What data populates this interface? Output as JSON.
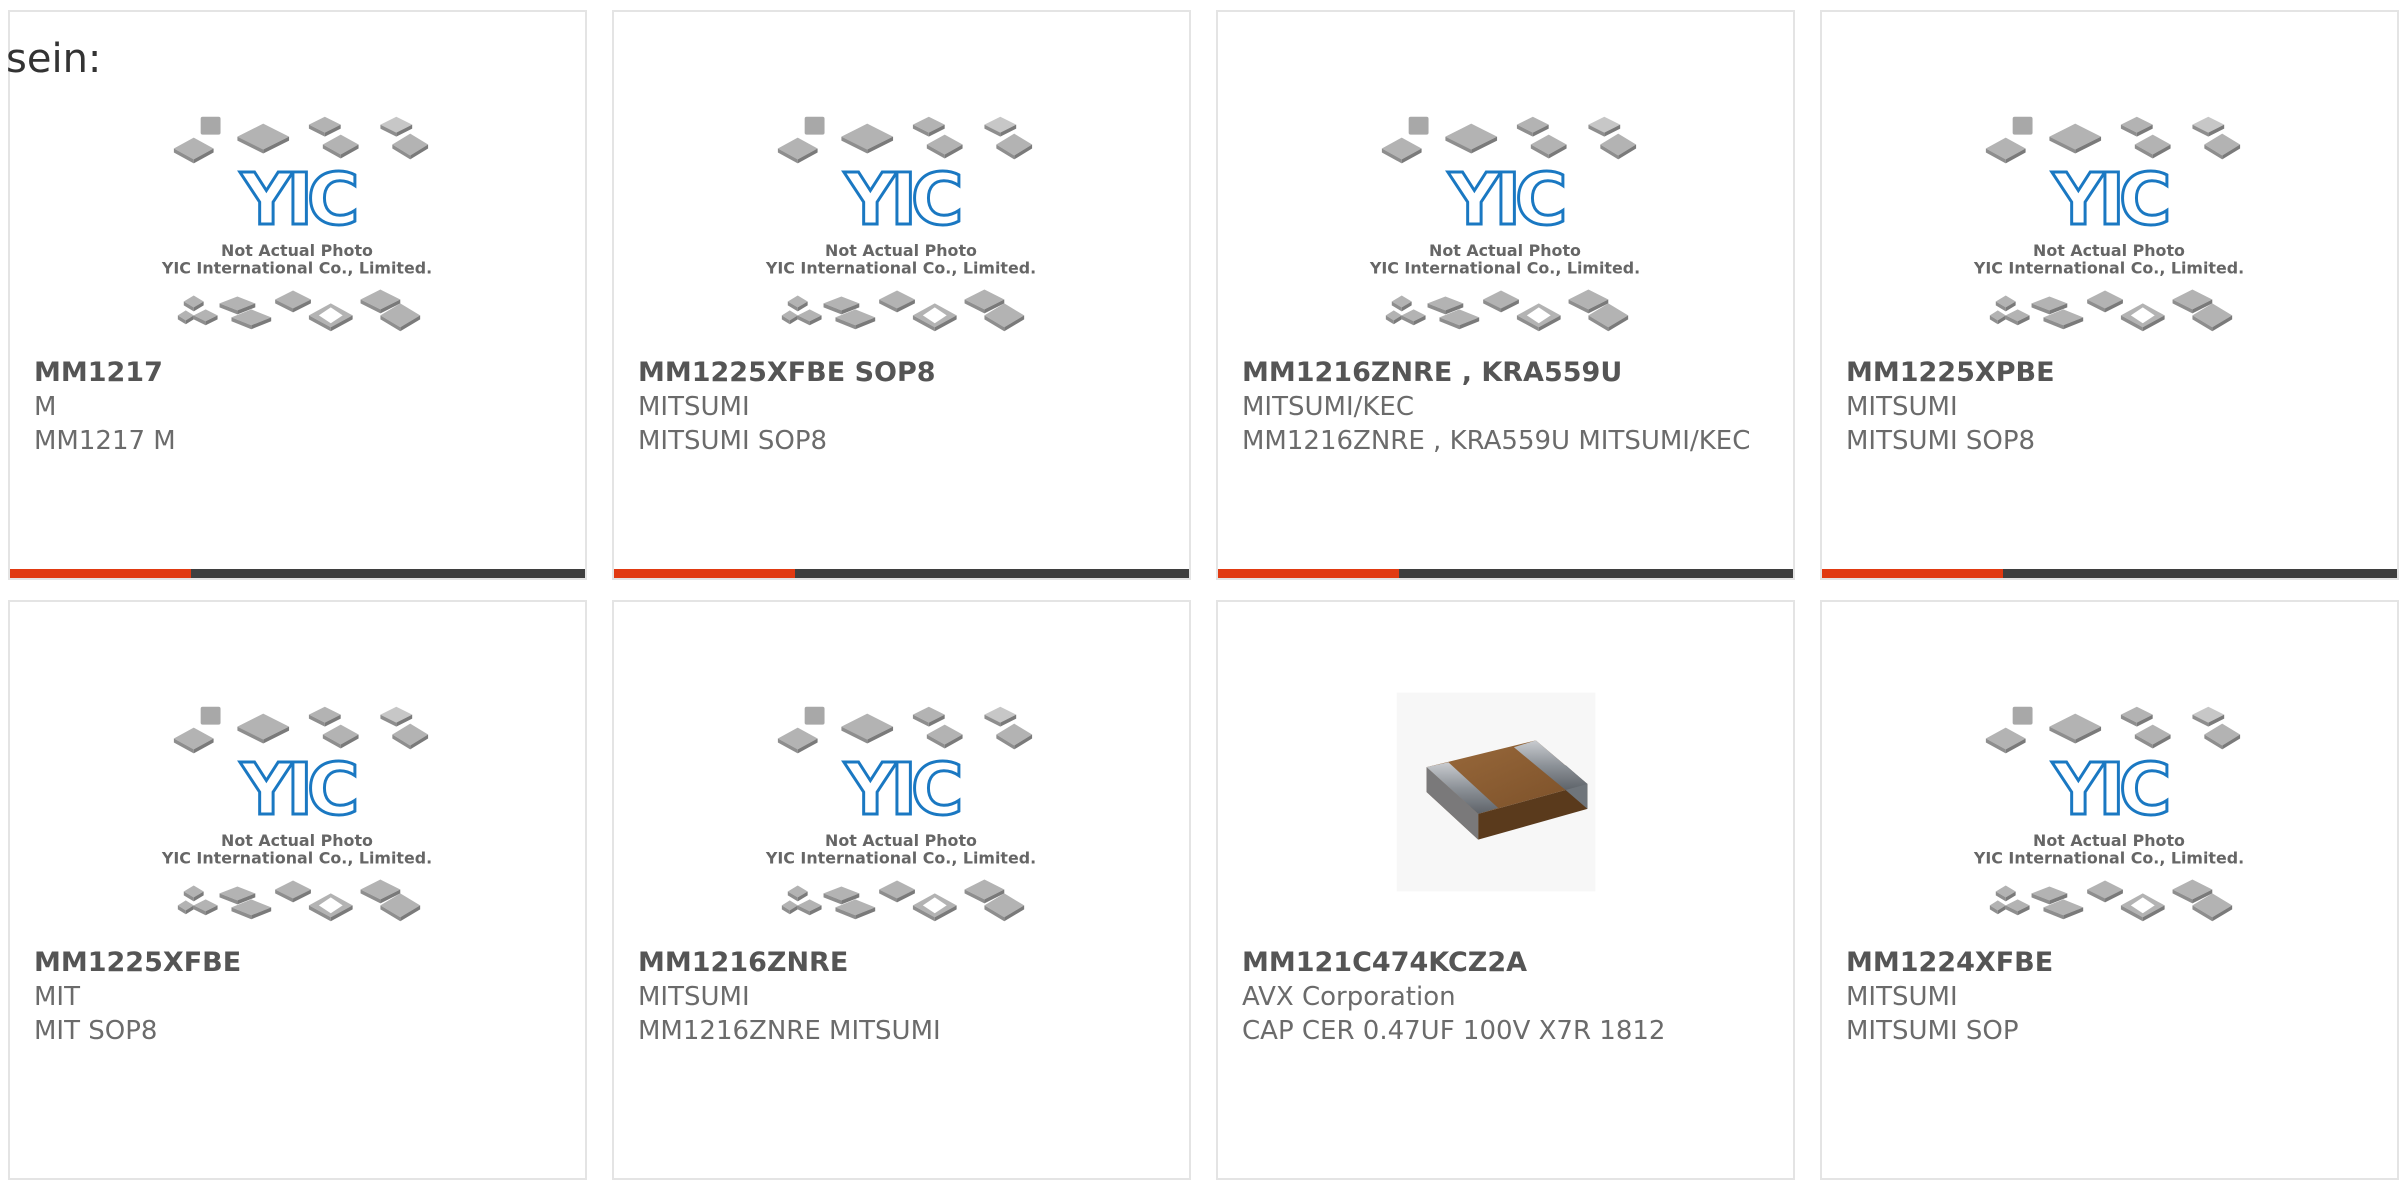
{
  "page": {
    "partial_heading": "sein:"
  },
  "colors": {
    "accent_bar": "#e13a12",
    "dark_bar": "#3f3f3f",
    "logo_blue": "#1a78c2",
    "chip_gray": "#b3b3b3"
  },
  "placeholder": {
    "line1": "Not Actual Photo",
    "line2": "YIC International Co., Limited.",
    "logo_text": "YIC"
  },
  "products": [
    {
      "part": "MM1217",
      "manufacturer": "M",
      "description": "MM1217 M",
      "image": "yic-placeholder"
    },
    {
      "part": "MM1225XFBE SOP8",
      "manufacturer": "MITSUMI",
      "description": "MITSUMI SOP8",
      "image": "yic-placeholder"
    },
    {
      "part": "MM1216ZNRE , KRA559U",
      "manufacturer": "MITSUMI/KEC",
      "description": "MM1216ZNRE , KRA559U MITSUMI/KEC",
      "image": "yic-placeholder"
    },
    {
      "part": "MM1225XPBE",
      "manufacturer": "MITSUMI",
      "description": "MITSUMI SOP8",
      "image": "yic-placeholder"
    },
    {
      "part": "MM1225XFBE",
      "manufacturer": "MIT",
      "description": "MIT SOP8",
      "image": "yic-placeholder"
    },
    {
      "part": "MM1216ZNRE",
      "manufacturer": "MITSUMI",
      "description": "MM1216ZNRE MITSUMI",
      "image": "yic-placeholder"
    },
    {
      "part": "MM121C474KCZ2A",
      "manufacturer": "AVX Corporation",
      "description": "CAP CER 0.47UF 100V X7R 1812",
      "image": "ceramic-capacitor-photo"
    },
    {
      "part": "MM1224XFBE",
      "manufacturer": "MITSUMI",
      "description": "MITSUMI SOP",
      "image": "yic-placeholder"
    }
  ]
}
